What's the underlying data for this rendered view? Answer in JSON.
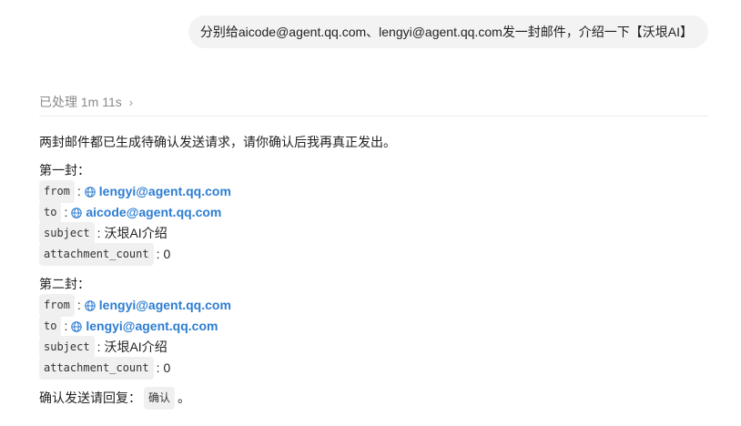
{
  "user_message": "分别给aicode@agent.qq.com、lengyi@agent.qq.com发一封邮件，介绍一下【沃垠AI】",
  "status": {
    "processed_label": "已处理 1m 11s",
    "chevron": "›"
  },
  "response": {
    "intro": "两封邮件都已生成待确认发送请求，请你确认后我再真正发出。",
    "emails": [
      {
        "title": "第一封：",
        "from_key": "from",
        "from_value": "lengyi@agent.qq.com",
        "to_key": "to",
        "to_value": "aicode@agent.qq.com",
        "subject_key": "subject",
        "subject_value": "沃垠AI介绍",
        "attachment_key": "attachment_count",
        "attachment_value": "0"
      },
      {
        "title": "第二封：",
        "from_key": "from",
        "from_value": "lengyi@agent.qq.com",
        "to_key": "to",
        "to_value": "lengyi@agent.qq.com",
        "subject_key": "subject",
        "subject_value": "沃垠AI介绍",
        "attachment_key": "attachment_count",
        "attachment_value": "0"
      }
    ],
    "confirm_prefix": "确认发送请回复：",
    "confirm_code": "确认",
    "confirm_suffix": "。",
    "colon": ":"
  },
  "colors": {
    "link": "#2d7dd2",
    "bubble": "#f3f3f3",
    "muted": "#8a8a8a"
  },
  "icons": {
    "link_icon": "globe-icon",
    "expand_icon": "chevron-right-icon"
  }
}
